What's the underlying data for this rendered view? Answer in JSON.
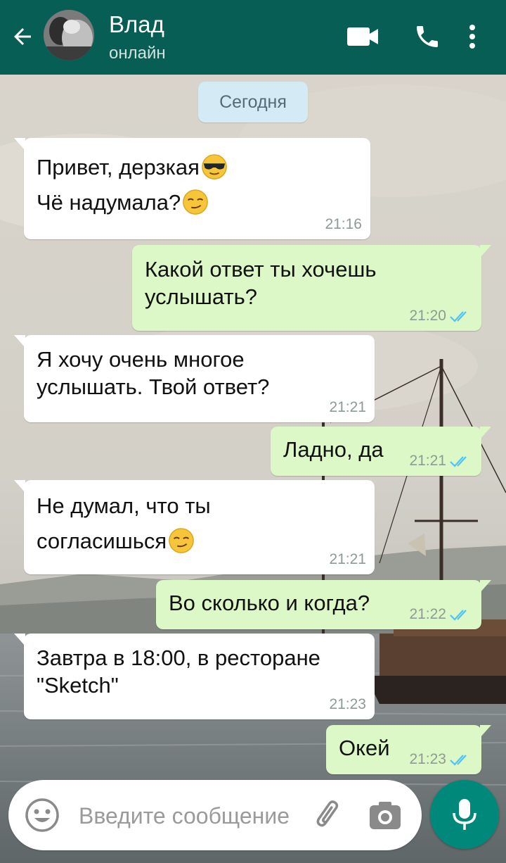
{
  "header": {
    "contact_name": "Влад",
    "status": "онлайн",
    "accent_color": "#075e54"
  },
  "date_chip": "Сегодня",
  "messages": [
    {
      "direction": "incoming",
      "lines": [
        "Привет, дерзкая",
        "Чё надумала?"
      ],
      "emojis": [
        "smiling-face-with-sunglasses",
        "smirking-face"
      ],
      "time": "21:16"
    },
    {
      "direction": "outgoing",
      "lines": [
        "Какой ответ ты хочешь",
        "услышать?"
      ],
      "time": "21:20",
      "status": "read"
    },
    {
      "direction": "incoming",
      "lines": [
        "Я хочу очень многое",
        "услышать. Твой ответ?"
      ],
      "time": "21:21"
    },
    {
      "direction": "outgoing",
      "lines": [
        "Ладно, да"
      ],
      "time": "21:21",
      "status": "read"
    },
    {
      "direction": "incoming",
      "lines": [
        "Не думал, что ты",
        "согласишься"
      ],
      "emojis": [
        "smirking-face"
      ],
      "time": "21:21"
    },
    {
      "direction": "outgoing",
      "lines": [
        "Во сколько и когда?"
      ],
      "time": "21:22",
      "status": "read"
    },
    {
      "direction": "incoming",
      "lines": [
        "Завтра в 18:00, в ресторане",
        "\"Sketch\""
      ],
      "time": "21:23"
    },
    {
      "direction": "outgoing",
      "lines": [
        "Окей"
      ],
      "time": "21:23",
      "status": "read"
    }
  ],
  "composer": {
    "placeholder": "Введите сообщение"
  },
  "icons": [
    "back-arrow-icon",
    "video-call-icon",
    "phone-icon",
    "more-vert-icon",
    "emoji-icon",
    "attach-icon",
    "camera-icon",
    "mic-icon"
  ],
  "colors": {
    "incoming_bubble": "#ffffff",
    "outgoing_bubble": "#dcf8c6",
    "read_ticks": "#4fc3f7",
    "mic_button": "#00897b"
  }
}
